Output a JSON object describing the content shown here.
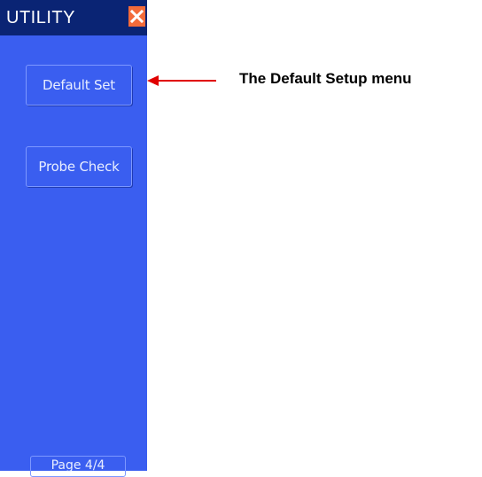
{
  "panel": {
    "title": "UTILITY",
    "close_icon": "close-x-icon",
    "buttons": [
      {
        "label": "Default Set"
      },
      {
        "label": "Probe Check"
      }
    ],
    "page_indicator": "Page 4/4"
  },
  "annotation": {
    "text": "The Default Setup menu",
    "arrow_color": "#e00000"
  },
  "colors": {
    "panel_bg": "#3a5ef0",
    "title_bg": "#0a2474",
    "close_bg": "#f36b3a"
  }
}
